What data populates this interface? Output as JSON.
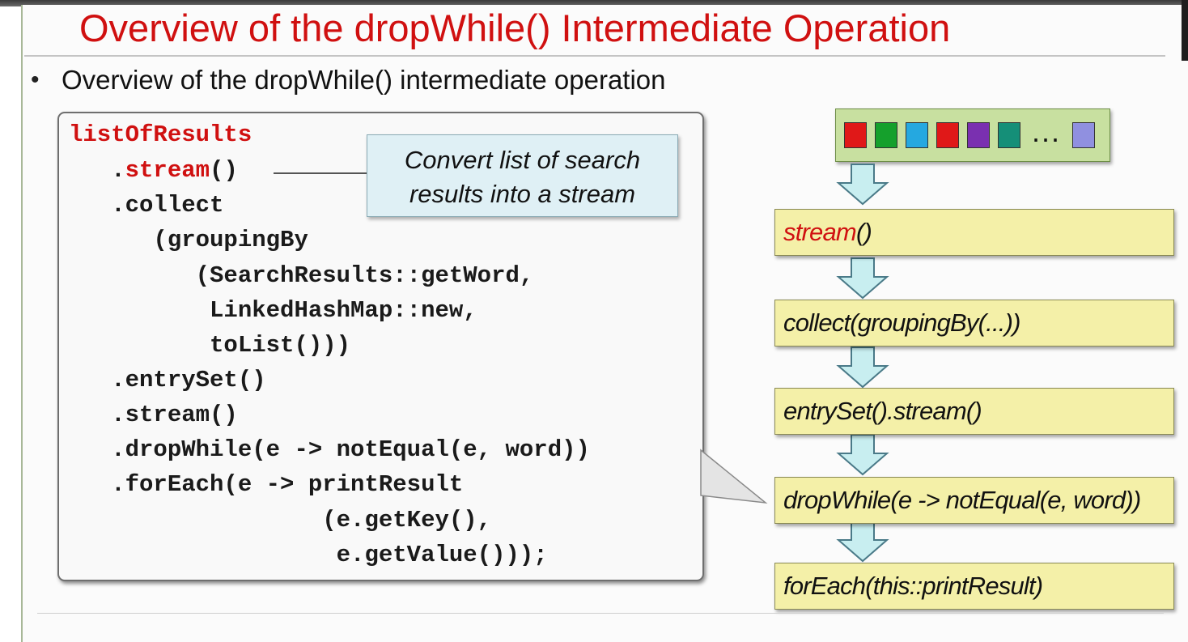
{
  "slide": {
    "title": "Overview of the dropWhile() Intermediate Operation",
    "bullet": "Overview of the dropWhile() intermediate operation"
  },
  "code": {
    "line1": "listOfResults",
    "line2_indent": "   .",
    "line2_red": "stream",
    "line2_rest": "()",
    "line3": "   .collect",
    "line4": "      (groupingBy",
    "line5": "         (SearchResults::getWord,",
    "line6": "          LinkedHashMap::new,",
    "line7": "          toList()))",
    "line8": "   .entrySet()",
    "line9": "   .stream()",
    "line10": "   .dropWhile(e -> notEqual(e, word))",
    "line11": "   .forEach(e -> printResult",
    "line12": "                  (e.getKey(),",
    "line13": "                   e.getValue()));"
  },
  "callout": {
    "line1": "Convert list of search",
    "line2": "results into a stream"
  },
  "pipeline": {
    "source_ellipsis": "...",
    "source_colors": [
      "#e01818",
      "#15a02c",
      "#25a8e0",
      "#e01818",
      "#7a30b0",
      "#158f78",
      "#9090e0"
    ],
    "stage1_red": "stream",
    "stage1_rest": "()",
    "stage2": "collect(groupingBy(...))",
    "stage3": "entrySet().stream()",
    "stage4": "dropWhile(e -> notEqual(e, word))",
    "stage5": "forEach(this::printResult)"
  },
  "colors": {
    "title_red": "#d01010",
    "callout_bg": "#dff0f5",
    "stage_bg": "#f4f0a8",
    "source_bg": "#c8e0a0",
    "arrow_fill": "#c8eef0"
  }
}
